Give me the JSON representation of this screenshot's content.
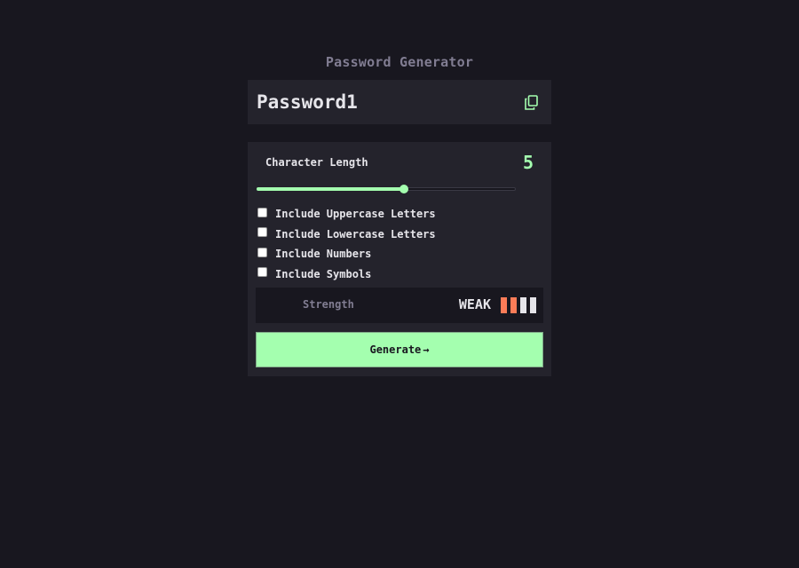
{
  "app": {
    "title": "Password Generator"
  },
  "password": {
    "value": "Password1",
    "copy_icon": "copy-icon"
  },
  "length": {
    "label": "Character Length",
    "value": "5",
    "slider_fraction": 0.57
  },
  "options": [
    {
      "label": "Include Uppercase Letters",
      "checked": false
    },
    {
      "label": "Include Lowercase Letters",
      "checked": false
    },
    {
      "label": "Include Numbers",
      "checked": false
    },
    {
      "label": "Include Symbols",
      "checked": false
    }
  ],
  "strength": {
    "label": "Strength",
    "value": "WEAK",
    "filled_bars": 2,
    "total_bars": 4
  },
  "generate": {
    "label": "Generate",
    "icon": "arrow-right-icon",
    "arrow": "→"
  },
  "colors": {
    "background": "#18171f",
    "panel": "#24232c",
    "accent": "#a4ffaf",
    "weak": "#f64a4a",
    "weak_bar": "#fb7c58",
    "muted": "#817d92"
  }
}
